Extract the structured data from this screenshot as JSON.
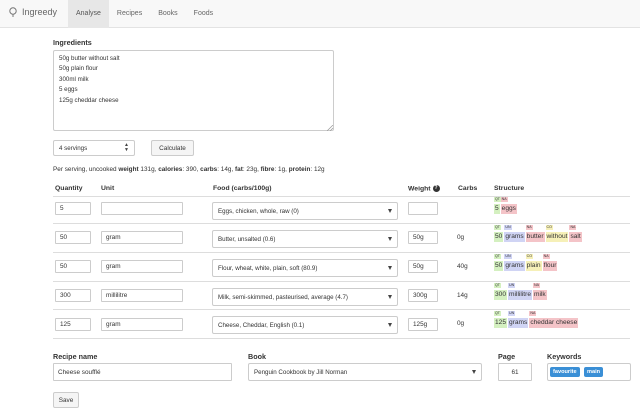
{
  "nav": {
    "brand": "Ingreedy",
    "tabs": [
      "Analyse",
      "Recipes",
      "Books",
      "Foods"
    ]
  },
  "ingredients": {
    "label": "Ingredients",
    "text": "50g butter without salt\n50g plain flour\n300ml milk\n5 eggs\n125g cheddar cheese"
  },
  "servings": {
    "selected": "4 servings"
  },
  "calculate_label": "Calculate",
  "summary": {
    "prefix": "Per serving, uncooked",
    "items": [
      {
        "label": "weight",
        "value": "131g"
      },
      {
        "label": "calories",
        "value": "390"
      },
      {
        "label": "carbs",
        "value": "14g"
      },
      {
        "label": "fat",
        "value": "23g"
      },
      {
        "label": "fibre",
        "value": "1g"
      },
      {
        "label": "protein",
        "value": "12g"
      }
    ]
  },
  "table": {
    "headers": {
      "quantity": "Quantity",
      "unit": "Unit",
      "food": "Food (carbs/100g)",
      "weight": "Weight",
      "carbs": "Carbs",
      "structure": "Structure"
    },
    "rows": [
      {
        "quantity": "5",
        "unit": "",
        "food": "Eggs, chicken, whole, raw (0)",
        "weight": "",
        "carbs": "",
        "structure": [
          {
            "tag": "QT",
            "word": "5",
            "color": "#d4f0c0"
          },
          {
            "tag": "NA",
            "word": "eggs",
            "color": "#f4c4c8"
          }
        ]
      },
      {
        "quantity": "50",
        "unit": "gram",
        "food": "Butter, unsalted (0.6)",
        "weight": "50g",
        "carbs": "0g",
        "structure": [
          {
            "tag": "QT",
            "word": "50",
            "color": "#d4f0c0"
          },
          {
            "tag": "UN",
            "word": "grams",
            "color": "#d0d4f4"
          },
          {
            "tag": "NA",
            "word": "butter",
            "color": "#f4c4c8"
          },
          {
            "tag": "CO",
            "word": "without",
            "color": "#f6f0b8"
          },
          {
            "tag": "NA",
            "word": "salt",
            "color": "#f4c4c8"
          }
        ]
      },
      {
        "quantity": "50",
        "unit": "gram",
        "food": "Flour, wheat, white, plain, soft (80.9)",
        "weight": "50g",
        "carbs": "40g",
        "structure": [
          {
            "tag": "QT",
            "word": "50",
            "color": "#d4f0c0"
          },
          {
            "tag": "UN",
            "word": "grams",
            "color": "#d0d4f4"
          },
          {
            "tag": "CO",
            "word": "plain",
            "color": "#f6f0b8"
          },
          {
            "tag": "NA",
            "word": "flour",
            "color": "#f4c4c8"
          }
        ]
      },
      {
        "quantity": "300",
        "unit": "millilitre",
        "food": "Milk, semi-skimmed, pasteurised, average (4.7)",
        "weight": "300g",
        "carbs": "14g",
        "structure": [
          {
            "tag": "QT",
            "word": "300",
            "color": "#d4f0c0"
          },
          {
            "tag": "UN",
            "word": "millilitre",
            "color": "#d0d4f4"
          },
          {
            "tag": "NA",
            "word": "milk",
            "color": "#f4c4c8"
          }
        ]
      },
      {
        "quantity": "125",
        "unit": "gram",
        "food": "Cheese, Cheddar, English (0.1)",
        "weight": "125g",
        "carbs": "0g",
        "structure": [
          {
            "tag": "QT",
            "word": "125",
            "color": "#d4f0c0"
          },
          {
            "tag": "UN",
            "word": "grams",
            "color": "#d0d4f4"
          },
          {
            "tag": "NA",
            "word": "cheddar cheese",
            "color": "#f4c4c8"
          }
        ]
      }
    ]
  },
  "recipe": {
    "name_label": "Recipe name",
    "name_value": "Cheese soufflé",
    "book_label": "Book",
    "book_value": "Penguin Cookbook by Jill Norman",
    "page_label": "Page",
    "page_value": "61",
    "keywords_label": "Keywords",
    "keywords": [
      "favourite",
      "main"
    ]
  },
  "save_label": "Save"
}
